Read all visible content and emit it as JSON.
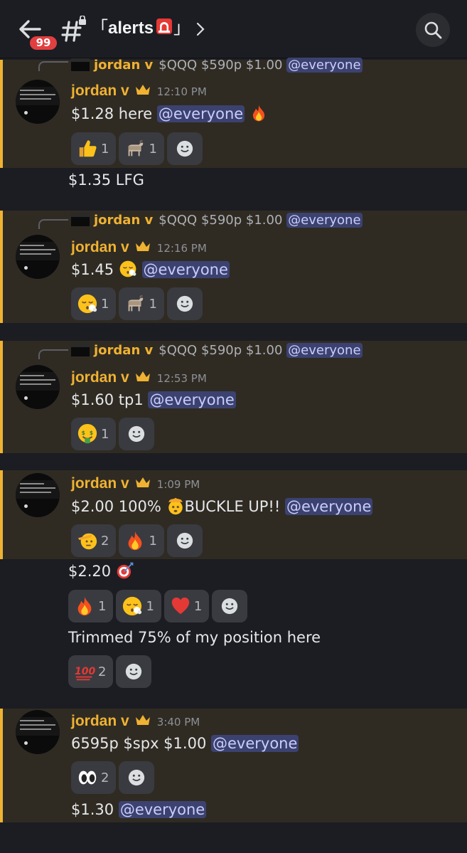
{
  "header": {
    "unread_count": "99",
    "channel_name": "alerts",
    "bracket_open": "「",
    "bracket_close": "」"
  },
  "colors": {
    "highlight_bg": "#2f2b23",
    "highlight_border": "#f0b232",
    "author_color": "#f0b232",
    "mention_bg": "#3c4270",
    "mention_text": "#c9cdfb"
  },
  "messages": [
    {
      "reply": {
        "author": "jordan v",
        "text": "$QQQ $590p $1.00",
        "mention": "@everyone"
      },
      "author": "jordan v",
      "time": "12:10 PM",
      "text": "$1.28 here",
      "mention": "@everyone",
      "trailing_emoji": "fire-emoji",
      "reactions": [
        {
          "emoji": "thumbs-up-emoji",
          "count": "1"
        },
        {
          "emoji": "goat-emoji",
          "count": "1"
        }
      ],
      "followups": [
        {
          "text": "$1.35 LFG"
        }
      ]
    },
    {
      "reply": {
        "author": "jordan v",
        "text": "$QQQ $590p $1.00",
        "mention": "@everyone"
      },
      "author": "jordan v",
      "time": "12:16 PM",
      "text": "$1.45",
      "text_emoji": "face-exhaling-emoji",
      "mention": "@everyone",
      "reactions": [
        {
          "emoji": "face-exhaling-emoji",
          "count": "1"
        },
        {
          "emoji": "goat-emoji",
          "count": "1"
        }
      ]
    },
    {
      "reply": {
        "author": "jordan v",
        "text": "$QQQ $590p $1.00",
        "mention": "@everyone"
      },
      "author": "jordan v",
      "time": "12:53 PM",
      "text": "$1.60 tp1",
      "mention": "@everyone",
      "reactions": [
        {
          "emoji": "money-mouth-emoji",
          "count": "1"
        }
      ]
    },
    {
      "author": "jordan v",
      "time": "1:09 PM",
      "text_before": "$2.00 100%",
      "text_emoji": "exploding-head-emoji",
      "text_after": "BUCKLE UP!!",
      "mention": "@everyone",
      "reactions": [
        {
          "emoji": "saluting-face-emoji",
          "count": "2"
        },
        {
          "emoji": "fire-emoji",
          "count": "1"
        }
      ],
      "followups": [
        {
          "text": "$2.20",
          "emoji": "direct-hit-emoji",
          "reactions": [
            {
              "emoji": "fire-emoji",
              "count": "1"
            },
            {
              "emoji": "face-exhaling-emoji",
              "count": "1"
            },
            {
              "emoji": "red-heart-emoji",
              "count": "1"
            }
          ]
        },
        {
          "text": "Trimmed 75% of my position here",
          "reactions": [
            {
              "emoji": "hundred-points-emoji",
              "count": "2"
            }
          ]
        }
      ]
    },
    {
      "author": "jordan v",
      "time": "3:40 PM",
      "text": "6595p $spx $1.00",
      "mention": "@everyone",
      "reactions": [
        {
          "emoji": "eyes-emoji",
          "count": "2"
        }
      ],
      "followups": [
        {
          "text": "$1.30",
          "mention": "@everyone"
        }
      ]
    }
  ]
}
